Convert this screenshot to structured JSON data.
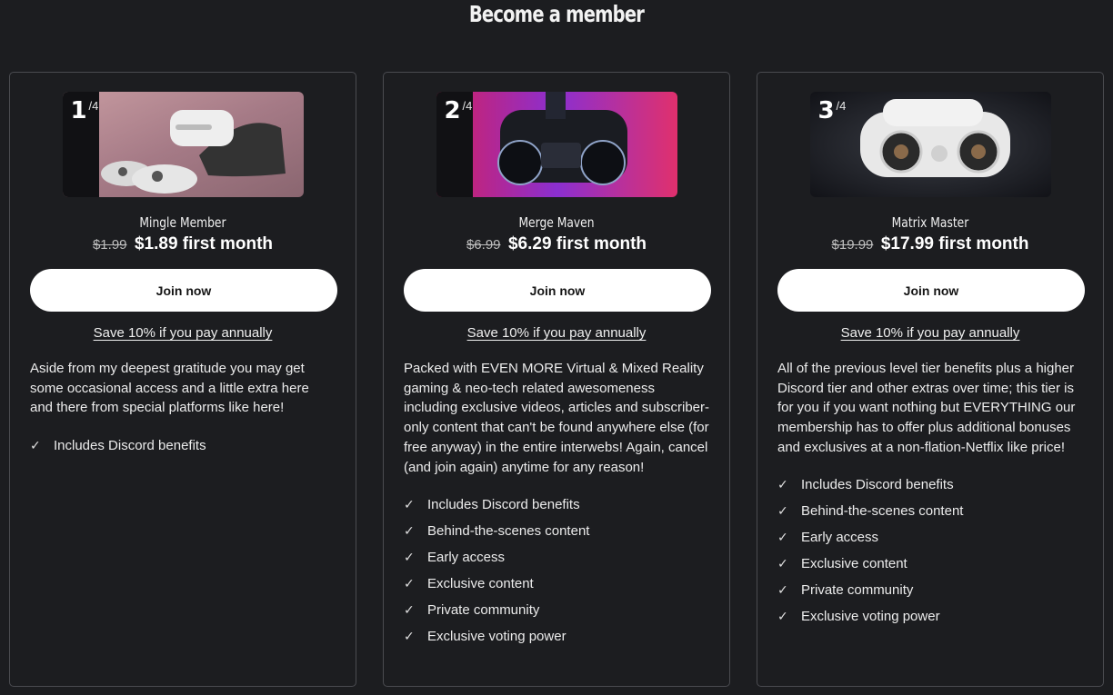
{
  "page": {
    "title": "Become a member"
  },
  "tiers": [
    {
      "number": "1",
      "of": "/4",
      "name": "Mingle Member",
      "price_old": "$1.99",
      "price_new": "$1.89 first month",
      "join_label": "Join now",
      "save_label": "Save 10% if you pay annually",
      "description": "Aside from my deepest gratitude you may get some occasional access and a little extra here and there from special platforms like here!",
      "benefits": [
        "Includes Discord benefits"
      ]
    },
    {
      "number": "2",
      "of": "/4",
      "name": "Merge Maven",
      "price_old": "$6.99",
      "price_new": "$6.29 first month",
      "join_label": "Join now",
      "save_label": "Save 10% if you pay annually",
      "description": "Packed with EVEN MORE Virtual & Mixed Reality gaming & neo-tech related awesomeness including exclusive videos, articles and subscriber-only content that can't be found anywhere else (for free anyway) in the entire interwebs! Again, cancel (and join again) anytime for any reason!",
      "benefits": [
        "Includes Discord benefits",
        "Behind-the-scenes content",
        "Early access",
        "Exclusive content",
        "Private community",
        "Exclusive voting power"
      ]
    },
    {
      "number": "3",
      "of": "/4",
      "name": "Matrix Master",
      "price_old": "$19.99",
      "price_new": "$17.99 first month",
      "join_label": "Join now",
      "save_label": "Save 10% if you pay annually",
      "description": "All of the previous level tier benefits plus a higher Discord tier and other extras over time; this tier is for you if you want nothing but EVERYTHING our membership has to offer plus additional bonuses and exclusives at a non-flation-Netflix like price!",
      "benefits": [
        "Includes Discord benefits",
        "Behind-the-scenes content",
        "Early access",
        "Exclusive content",
        "Private community",
        "Exclusive voting power"
      ]
    }
  ],
  "icons": {
    "check": "check-icon"
  }
}
